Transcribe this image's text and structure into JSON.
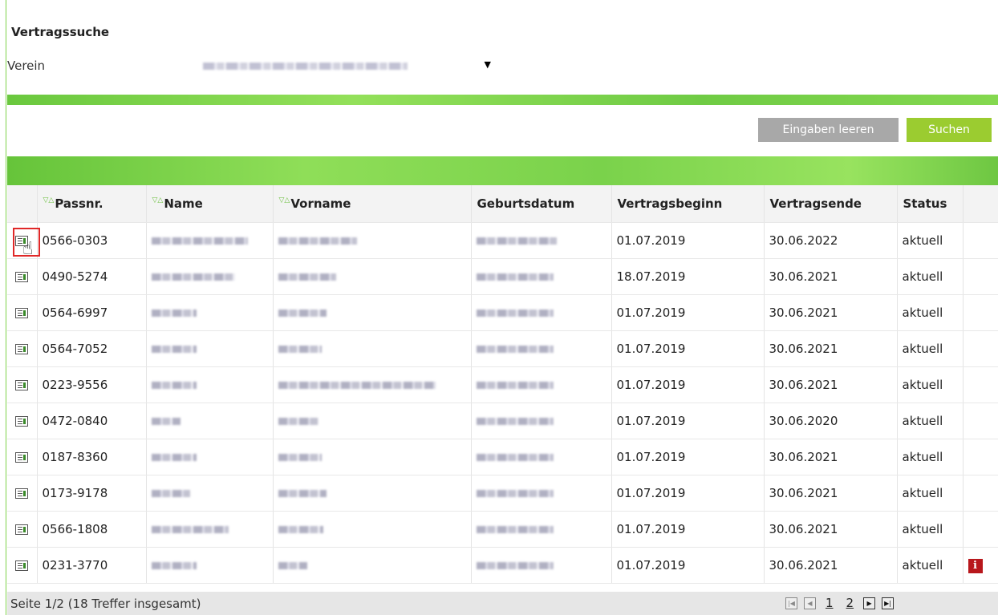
{
  "page": {
    "title": "Vertragssuche"
  },
  "filter": {
    "verein_label": "Verein",
    "verein_selected": ""
  },
  "buttons": {
    "clear": "Eingaben leeren",
    "search": "Suchen"
  },
  "table": {
    "columns": [
      "Passnr.",
      "Name",
      "Vorname",
      "Geburtsdatum",
      "Vertragsbeginn",
      "Vertragsende",
      "Status"
    ],
    "rows": [
      {
        "passnr": "0566-0303",
        "beginn": "01.07.2019",
        "ende": "30.06.2022",
        "status": "aktuell",
        "info": false
      },
      {
        "passnr": "0490-5274",
        "beginn": "18.07.2019",
        "ende": "30.06.2021",
        "status": "aktuell",
        "info": false
      },
      {
        "passnr": "0564-6997",
        "beginn": "01.07.2019",
        "ende": "30.06.2021",
        "status": "aktuell",
        "info": false
      },
      {
        "passnr": "0564-7052",
        "beginn": "01.07.2019",
        "ende": "30.06.2021",
        "status": "aktuell",
        "info": false
      },
      {
        "passnr": "0223-9556",
        "beginn": "01.07.2019",
        "ende": "30.06.2021",
        "status": "aktuell",
        "info": false
      },
      {
        "passnr": "0472-0840",
        "beginn": "01.07.2019",
        "ende": "30.06.2020",
        "status": "aktuell",
        "info": false
      },
      {
        "passnr": "0187-8360",
        "beginn": "01.07.2019",
        "ende": "30.06.2021",
        "status": "aktuell",
        "info": false
      },
      {
        "passnr": "0173-9178",
        "beginn": "01.07.2019",
        "ende": "30.06.2021",
        "status": "aktuell",
        "info": false
      },
      {
        "passnr": "0566-1808",
        "beginn": "01.07.2019",
        "ende": "30.06.2021",
        "status": "aktuell",
        "info": false
      },
      {
        "passnr": "0231-3770",
        "beginn": "01.07.2019",
        "ende": "30.06.2021",
        "status": "aktuell",
        "info": true
      }
    ]
  },
  "footer": {
    "info": "Seite 1/2 (18 Treffer insgesamt)",
    "pages": [
      "1",
      "2"
    ]
  },
  "icons": {
    "row": "detail-icon",
    "info": "info-icon",
    "badge_letter": "i"
  },
  "colors": {
    "accent_green": "#8fde58",
    "search_button": "#9bcc30",
    "clear_button": "#a8a8a8",
    "info_red": "#b8171c"
  }
}
